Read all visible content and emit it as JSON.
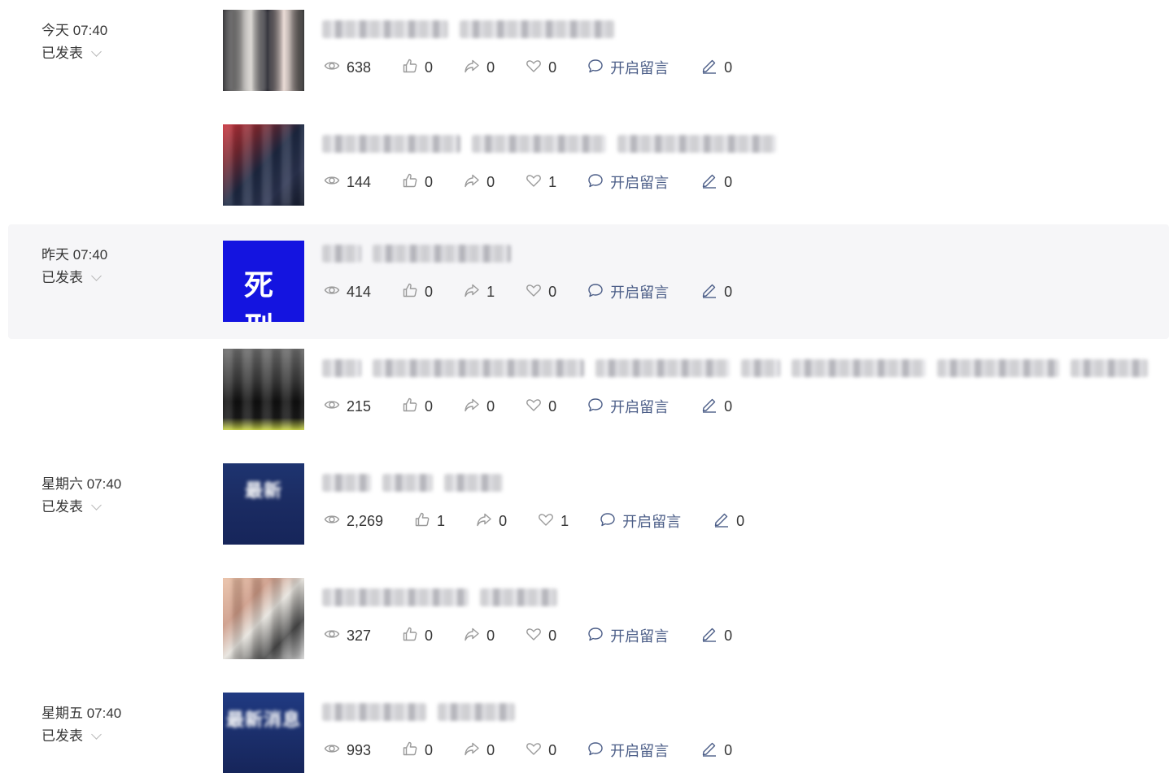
{
  "articles": [
    {
      "date": "今天 07:40",
      "status": "已发表",
      "thumb_text": "",
      "title_segments": [
        155,
        190
      ],
      "views": "638",
      "likes": "0",
      "shares": "0",
      "favorites": "0",
      "comment_label": "开启留言",
      "edits": "0"
    },
    {
      "date": "",
      "status": "",
      "thumb_text": "",
      "title_segments": [
        170,
        165,
        195
      ],
      "views": "144",
      "likes": "0",
      "shares": "0",
      "favorites": "1",
      "comment_label": "开启留言",
      "edits": "0"
    },
    {
      "date": "昨天 07:40",
      "status": "已发表",
      "thumb_text": "死 刑",
      "title_segments": [
        48,
        170
      ],
      "views": "414",
      "likes": "0",
      "shares": "1",
      "favorites": "0",
      "comment_label": "开启留言",
      "edits": "0"
    },
    {
      "date": "",
      "status": "",
      "thumb_text": "",
      "title_segments": [
        48,
        260,
        165,
        48,
        165,
        150,
        95
      ],
      "views": "215",
      "likes": "0",
      "shares": "0",
      "favorites": "0",
      "comment_label": "开启留言",
      "edits": "0"
    },
    {
      "date": "星期六 07:40",
      "status": "已发表",
      "thumb_text": "最新",
      "title_segments": [
        60,
        62,
        72
      ],
      "views": "2,269",
      "likes": "1",
      "shares": "0",
      "favorites": "1",
      "comment_label": "开启留言",
      "edits": "0"
    },
    {
      "date": "",
      "status": "",
      "thumb_text": "",
      "title_segments": [
        180,
        95
      ],
      "views": "327",
      "likes": "0",
      "shares": "0",
      "favorites": "0",
      "comment_label": "开启留言",
      "edits": "0"
    },
    {
      "date": "星期五 07:40",
      "status": "已发表",
      "thumb_text": "最新消息",
      "title_segments": [
        128,
        95
      ],
      "views": "993",
      "likes": "0",
      "shares": "0",
      "favorites": "0",
      "comment_label": "开启留言",
      "edits": "0"
    }
  ],
  "icons": {
    "views": "eye-icon",
    "likes": "thumbs-up-icon",
    "shares": "share-icon",
    "favorites": "heart-icon",
    "comment": "comment-icon",
    "edit": "pencil-icon",
    "status_dropdown": "chevron-down-icon"
  },
  "colors": {
    "text": "#353535",
    "icon": "#9a9a9a",
    "comment_link": "#4b5d87",
    "highlight_row": "#f6f6f8"
  }
}
